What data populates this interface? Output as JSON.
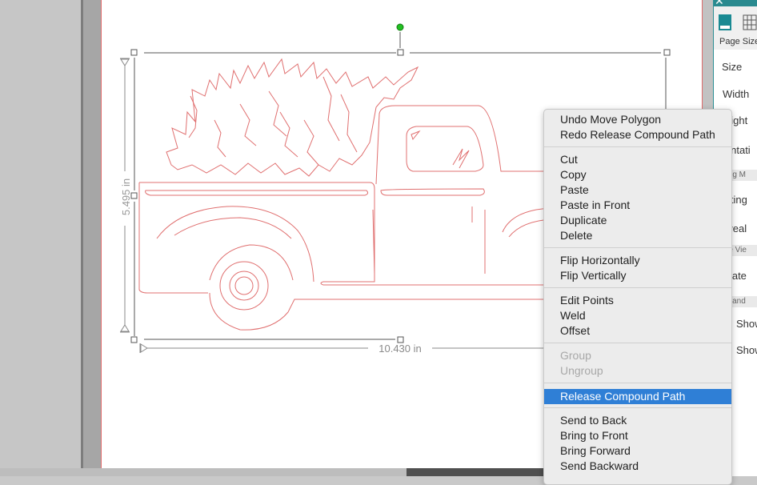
{
  "canvas": {
    "height_dimension": "5.495 in",
    "width_dimension": "10.430 in"
  },
  "context_menu": {
    "items": [
      {
        "label": "Undo Move Polygon",
        "enabled": true
      },
      {
        "label": "Redo Release Compound Path",
        "enabled": true
      },
      {
        "label": "Cut",
        "enabled": true
      },
      {
        "label": "Copy",
        "enabled": true
      },
      {
        "label": "Paste",
        "enabled": true
      },
      {
        "label": "Paste in Front",
        "enabled": true
      },
      {
        "label": "Duplicate",
        "enabled": true
      },
      {
        "label": "Delete",
        "enabled": true
      },
      {
        "label": "Flip Horizontally",
        "enabled": true
      },
      {
        "label": "Flip Vertically",
        "enabled": true
      },
      {
        "label": "Edit Points",
        "enabled": true
      },
      {
        "label": "Weld",
        "enabled": true
      },
      {
        "label": "Offset",
        "enabled": true
      },
      {
        "label": "Group",
        "enabled": false
      },
      {
        "label": "Ungroup",
        "enabled": false
      },
      {
        "label": "Release Compound Path",
        "enabled": true,
        "highlighted": true
      },
      {
        "label": "Send to Back",
        "enabled": true
      },
      {
        "label": "Bring to Front",
        "enabled": true
      },
      {
        "label": "Bring Forward",
        "enabled": true
      },
      {
        "label": "Send Backward",
        "enabled": true
      }
    ]
  },
  "panel": {
    "close_glyph": "✕",
    "tab_label": "Page Size",
    "rows": {
      "size": "Size",
      "width": "Width",
      "height": "eight",
      "orientation": "ientati",
      "cutting_mat_section": "tting M",
      "cutting": "utting",
      "reveal": "eveal",
      "rotate_view_section": "ate Vie",
      "rotate": "otate",
      "print_section": "nt and",
      "show1": "Show",
      "show2": "Show"
    }
  },
  "colors": {
    "accent": "#2a8a8f",
    "cut_line": "#e07070",
    "highlight": "#2f7fd6",
    "handle_rotate": "#22c022"
  },
  "icons": {
    "panel_tab_1": "page-setup-icon",
    "panel_tab_2": "grid-icon",
    "close": "close-icon",
    "rotate_handle": "rotate-handle-icon"
  }
}
